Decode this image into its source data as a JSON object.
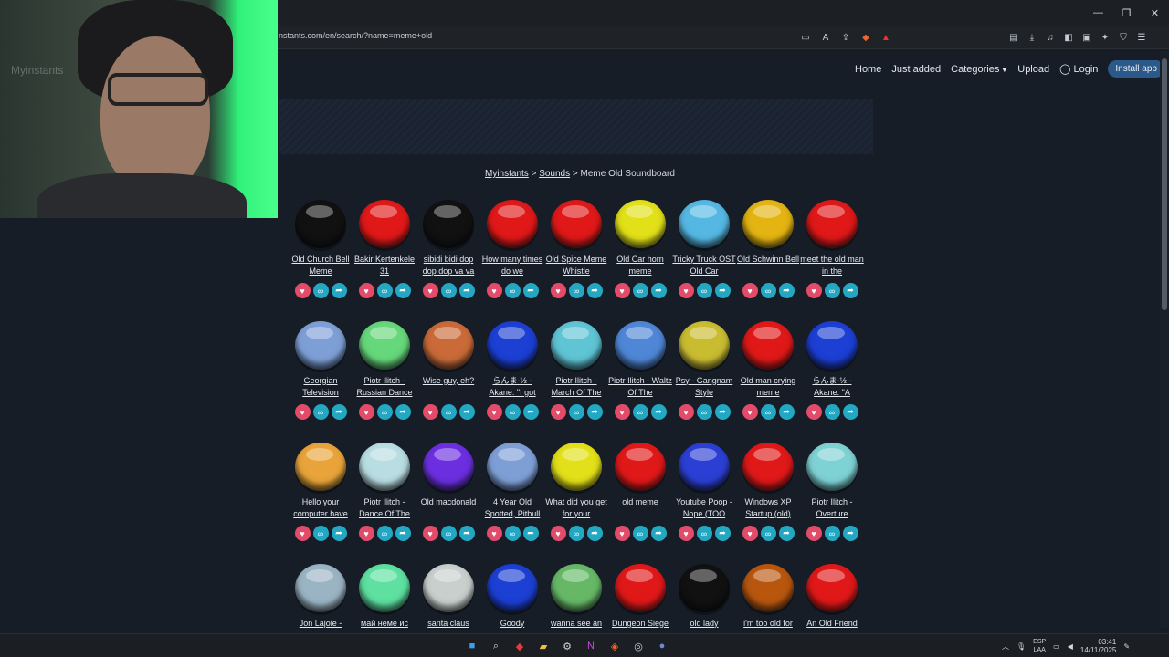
{
  "browser": {
    "url": "nstants.com/en/search/?name=meme+old"
  },
  "site": {
    "logo_text": "Myinstants",
    "nav": [
      {
        "label": "Home"
      },
      {
        "label": "Just added"
      },
      {
        "label": "Categories"
      },
      {
        "label": "Upload"
      },
      {
        "label": "Login"
      }
    ],
    "install_label": "Install app"
  },
  "breadcrumb": {
    "home": "Myinstants",
    "sounds": "Sounds",
    "current": "> Meme Old Soundboard",
    "sep": ">"
  },
  "sounds": [
    {
      "label": "Old Church Bell Meme",
      "color": "#111111"
    },
    {
      "label": "Bakir Kertenkele 31",
      "color": "#e01818"
    },
    {
      "label": "sibidi bidi dop dop dop va va",
      "color": "#111111"
    },
    {
      "label": "How many times do we",
      "color": "#e01818"
    },
    {
      "label": "Old Spice Meme Whistle",
      "color": "#e01818"
    },
    {
      "label": "Old Car horn meme",
      "color": "#e2e018"
    },
    {
      "label": "Tricky Truck OST Old Car",
      "color": "#55b8e3"
    },
    {
      "label": "Old Schwinn Bell",
      "color": "#e3b412"
    },
    {
      "label": "meet the old man in the",
      "color": "#e01818"
    },
    {
      "label": "Georgian Television",
      "color": "#7e9fd6"
    },
    {
      "label": "Piotr Ilitch - Russian Dance",
      "color": "#66d77a"
    },
    {
      "label": "Wise guy, eh?",
      "color": "#c96a38"
    },
    {
      "label": "らんま-½ - Akane: \"I got",
      "color": "#1c3fd4"
    },
    {
      "label": "Piotr Ilitch - March Of The",
      "color": "#5fc4d4"
    },
    {
      "label": "Piotr Ilitch - Waltz Of The",
      "color": "#4f86d6"
    },
    {
      "label": "Psy - Gangnam Style",
      "color": "#c9bc31"
    },
    {
      "label": "Old man crying meme",
      "color": "#e01818"
    },
    {
      "label": "らんま-½ - Akane: \"A",
      "color": "#1c3fd4"
    },
    {
      "label": "Hello your computer have",
      "color": "#e8a43a"
    },
    {
      "label": "Piotr Ilitch - Dance Of The",
      "color": "#b8dde2"
    },
    {
      "label": "Old macdonald",
      "color": "#6b2fe0"
    },
    {
      "label": "4 Year Old Spotted, Pitbull",
      "color": "#7e9fd6"
    },
    {
      "label": "What did you get for your",
      "color": "#e2e018"
    },
    {
      "label": "old meme",
      "color": "#e01818"
    },
    {
      "label": "Youtube Poop - Nope (TOO",
      "color": "#2b3fd4"
    },
    {
      "label": "Windows XP Startup (old)",
      "color": "#e01818"
    },
    {
      "label": "Piotr Ilitch - Overture",
      "color": "#7ed2d4"
    },
    {
      "label": "Jon Lajoie -",
      "color": "#9bb4c4"
    },
    {
      "label": "май неме ис",
      "color": "#5de0a0"
    },
    {
      "label": "santa claus",
      "color": "#c8cfcc"
    },
    {
      "label": "Goody",
      "color": "#1c3fd4"
    },
    {
      "label": "wanna see an",
      "color": "#66b866"
    },
    {
      "label": "Dungeon Siege",
      "color": "#e01818"
    },
    {
      "label": "old lady",
      "color": "#111111"
    },
    {
      "label": "i'm too old for",
      "color": "#b8560e"
    },
    {
      "label": "An Old Friend",
      "color": "#e01818"
    }
  ],
  "taskbar": {
    "lang_top": "ESP",
    "lang_bottom": "LAA",
    "time": "03:41",
    "date": "14/11/2025"
  }
}
